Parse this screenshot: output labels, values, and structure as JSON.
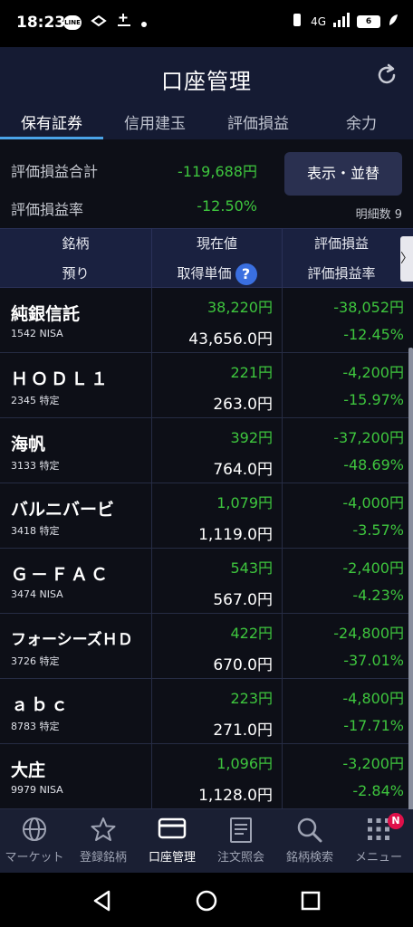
{
  "status_bar": {
    "time": "18:23",
    "line_icon_text": "LINE",
    "network": "4G",
    "battery": "6"
  },
  "header": {
    "title": "口座管理"
  },
  "tabs": [
    {
      "label": "保有証券",
      "active": true
    },
    {
      "label": "信用建玉",
      "active": false
    },
    {
      "label": "評価損益",
      "active": false
    },
    {
      "label": "余力",
      "active": false
    }
  ],
  "summary": {
    "pl_total_label": "評価損益合計",
    "pl_total_value": "-119,688円",
    "pl_rate_label": "評価損益率",
    "pl_rate_value": "-12.50%",
    "display_button": "表示・並替",
    "detail_count": "明細数 9"
  },
  "table_header": {
    "col1_top": "銘柄",
    "col1_bottom": "預り",
    "col2_top": "現在値",
    "col2_bottom": "取得単価",
    "col3_top": "評価損益",
    "col3_bottom": "評価損益率",
    "help": "?",
    "scroll_right": "〉"
  },
  "holdings": [
    {
      "name": "純銀信託",
      "code": "1542 NISA",
      "price": "38,220円",
      "cost": "43,656.0円",
      "pl": "-38,052円",
      "pl_rate": "-12.45%"
    },
    {
      "name": "ＨＯＤＬ１",
      "code": "2345 特定",
      "price": "221円",
      "cost": "263.0円",
      "pl": "-4,200円",
      "pl_rate": "-15.97%"
    },
    {
      "name": "海帆",
      "code": "3133 特定",
      "price": "392円",
      "cost": "764.0円",
      "pl": "-37,200円",
      "pl_rate": "-48.69%"
    },
    {
      "name": "バルニバービ",
      "code": "3418 特定",
      "price": "1,079円",
      "cost": "1,119.0円",
      "pl": "-4,000円",
      "pl_rate": "-3.57%"
    },
    {
      "name": "Ｇ－ＦＡＣ",
      "code": "3474 NISA",
      "price": "543円",
      "cost": "567.0円",
      "pl": "-2,400円",
      "pl_rate": "-4.23%"
    },
    {
      "name": "フォーシーズＨＤ",
      "code": "3726 特定",
      "price": "422円",
      "cost": "670.0円",
      "pl": "-24,800円",
      "pl_rate": "-37.01%"
    },
    {
      "name": "ａｂｃ",
      "code": "8783 特定",
      "price": "223円",
      "cost": "271.0円",
      "pl": "-4,800円",
      "pl_rate": "-17.71%"
    },
    {
      "name": "大庄",
      "code": "9979 NISA",
      "price": "1,096円",
      "cost": "1,128.0円",
      "pl": "-3,200円",
      "pl_rate": "-2.84%"
    }
  ],
  "bottom_nav": [
    {
      "label": "マーケット",
      "icon": "globe-icon",
      "active": false
    },
    {
      "label": "登録銘柄",
      "icon": "star-icon",
      "active": false
    },
    {
      "label": "口座管理",
      "icon": "card-icon",
      "active": true
    },
    {
      "label": "注文照会",
      "icon": "document-icon",
      "active": false
    },
    {
      "label": "銘柄検索",
      "icon": "search-icon",
      "active": false
    },
    {
      "label": "メニュー",
      "icon": "grid-icon",
      "active": false,
      "badge": "N"
    }
  ],
  "colors": {
    "gain_loss_green": "#3ec63e",
    "header_bg": "#151b33",
    "accent": "#4aa3e8"
  }
}
